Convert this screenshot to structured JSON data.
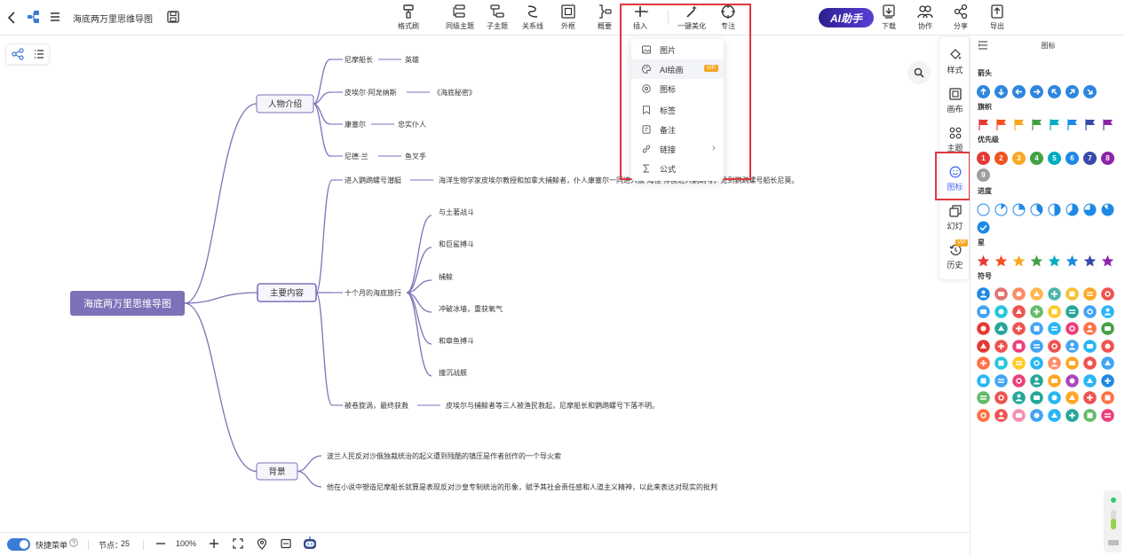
{
  "app": {
    "doc_title": "海底两万里思维导图"
  },
  "toolbar": {
    "buttons": [
      {
        "id": "format",
        "label": "格式刷"
      },
      {
        "id": "sibling",
        "label": "同级主题"
      },
      {
        "id": "child",
        "label": "子主题"
      },
      {
        "id": "relation",
        "label": "关系线"
      },
      {
        "id": "frame",
        "label": "外框"
      },
      {
        "id": "summary",
        "label": "概要"
      },
      {
        "id": "insert",
        "label": "插入"
      },
      {
        "id": "beautify",
        "label": "一键美化"
      },
      {
        "id": "focus",
        "label": "专注"
      },
      {
        "id": "download",
        "label": "下载"
      },
      {
        "id": "collab",
        "label": "协作"
      },
      {
        "id": "share",
        "label": "分享"
      },
      {
        "id": "export",
        "label": "导出"
      }
    ],
    "ai_label": "AI助手"
  },
  "insert_menu": {
    "items": [
      {
        "label": "图片",
        "icon": "image-icon"
      },
      {
        "label": "AI绘画",
        "icon": "palette-icon",
        "badge": "VIP"
      },
      {
        "label": "图标",
        "icon": "icon-icon"
      },
      {
        "label": "标签",
        "icon": "tag-icon"
      },
      {
        "label": "备注",
        "icon": "note-icon"
      },
      {
        "label": "链接",
        "icon": "link-icon",
        "arrow": "›"
      },
      {
        "label": "公式",
        "icon": "formula-icon"
      }
    ]
  },
  "mindmap": {
    "root": "海底两万里思维导图",
    "branches": [
      {
        "label": "人物介绍",
        "children": [
          {
            "label": "尼摩船长",
            "detail": "英雄"
          },
          {
            "label": "皮埃尔·阿龙纳斯",
            "detail": "《海底秘密》"
          },
          {
            "label": "康塞尔",
            "detail": "忠实仆人"
          },
          {
            "label": "尼德·兰",
            "detail": "鱼叉手"
          }
        ]
      },
      {
        "label": "主要内容",
        "children": [
          {
            "label": "进入鹦鹉螺号潜艇",
            "detail": "海洋生物学家皮埃尔教授和加拿大捕鲸者，仆人康塞尔一同进入被“海怪”俘虏进入鹦鹉号，见到鹦鹉螺号船长尼莫。"
          },
          {
            "label": "十个月的海底旅行",
            "subs": [
              "与土著战斗",
              "和巨鲨搏斗",
              "捕鲸",
              "冲破冰墙，重获氧气",
              "和章鱼搏斗",
              "撞沉战舰"
            ]
          },
          {
            "label": "被卷旋涡，最终获救",
            "detail": "皮埃尔与捕鲸者等三人被渔民救起，尼摩船长和鹦鹉螺号下落不明。"
          }
        ]
      },
      {
        "label": "背景",
        "children": [
          {
            "label": "波兰人民反对沙俄独裁统治的起义遭到残酷的镇压是作者创作的一个导火索"
          },
          {
            "label": "他在小说中塑造尼摩船长就算是表现反对沙皇专制统治的形象，赋予其社会责任感和人道主义精神，以此来表达对现实的批判"
          }
        ]
      }
    ]
  },
  "side_tabs": [
    {
      "label": "样式",
      "icon": "style-icon"
    },
    {
      "label": "画布",
      "icon": "canvas-icon"
    },
    {
      "label": "主题",
      "icon": "theme-icon"
    },
    {
      "label": "图标",
      "icon": "smile-icon",
      "active": true
    },
    {
      "label": "幻灯",
      "icon": "slides-icon"
    },
    {
      "label": "历史",
      "icon": "history-icon",
      "badge": "VIP"
    }
  ],
  "icon_panel": {
    "title": "图标",
    "sections": [
      {
        "title": "箭头",
        "kind": "arrows"
      },
      {
        "title": "旗帜",
        "kind": "flags"
      },
      {
        "title": "优先级",
        "kind": "priority",
        "numbers": [
          "1",
          "2",
          "3",
          "4",
          "5",
          "6",
          "7",
          "8",
          "9"
        ]
      },
      {
        "title": "进度",
        "kind": "progress"
      },
      {
        "title": "星",
        "kind": "stars"
      },
      {
        "title": "符号",
        "kind": "symbols"
      }
    ],
    "colors": {
      "arrow": "#2e86de",
      "flags": [
        "#e53935",
        "#f4511e",
        "#f9a825",
        "#43a047",
        "#00acc1",
        "#1e88e5",
        "#3949ab",
        "#8e24aa"
      ],
      "priority": [
        "#e53935",
        "#f4511e",
        "#f9a825",
        "#43a047",
        "#00acc1",
        "#1e88e5",
        "#3949ab",
        "#8e24aa",
        "#9e9e9e"
      ],
      "stars": [
        "#e53935",
        "#f4511e",
        "#f9a825",
        "#43a047",
        "#00acc1",
        "#1e88e5",
        "#3949ab",
        "#8e24aa"
      ],
      "progress": "#1e88e5"
    }
  },
  "bottombar": {
    "quick_menu": "快捷菜单",
    "nodes_label": "节点：",
    "nodes_count": "25",
    "zoom": "100%"
  },
  "colors": {
    "root_fill": "#7b72b8",
    "branch_line": "#7b72b8",
    "accent": "#4a6cf7",
    "highlight": "#e0383e"
  }
}
